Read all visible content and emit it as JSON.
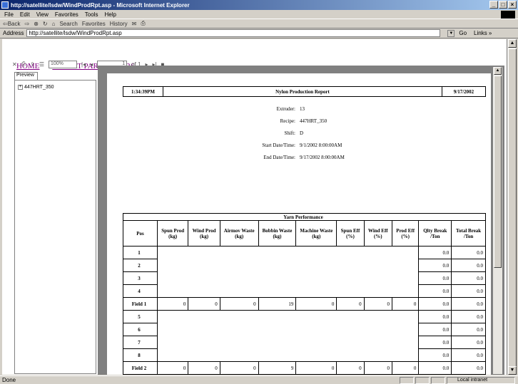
{
  "window": {
    "title": "http://satellite/lsdw/WindProdRpt.asp - Microsoft Internet Explorer"
  },
  "menu": {
    "items": [
      "File",
      "Edit",
      "View",
      "Favorites",
      "Tools",
      "Help"
    ]
  },
  "toolbar": {
    "back": "⇦Back",
    "search": "Search",
    "favorites": "Favorites",
    "history": "History"
  },
  "address": {
    "label": "Address",
    "url": "http://satellite/lsdw/WindProdRpt.asp",
    "go": "Go",
    "links": "Links »"
  },
  "nav": {
    "home": "HOME",
    "params": "REPORT PARAMETERS"
  },
  "viewer": {
    "zoom": "100%",
    "page": "1",
    "of": "of 1",
    "preview_tab": "Preview",
    "tree_node": "447HRT_350"
  },
  "report": {
    "time": "1:34:39PM",
    "title": "Nylon Production Report",
    "date": "9/17/2002",
    "info": [
      {
        "label": "Extruder:",
        "value": "13"
      },
      {
        "label": "Recipe:",
        "value": "447HRT_350"
      },
      {
        "label": "Shift:",
        "value": "D"
      },
      {
        "label": "Start Date/Time:",
        "value": "9/1/2002  8:00:00AM"
      },
      {
        "label": "End Date/Time:",
        "value": "9/17/2002  8:00:00AM"
      }
    ],
    "perf_title": "Yarn Performance",
    "columns": [
      "Pos",
      "Spun Prod (kg)",
      "Wind Prod (kg)",
      "Airmov Waste (kg)",
      "Bobbin Waste (kg)",
      "Machine Waste (kg)",
      "Spun Eff (%)",
      "Wind Eff (%)",
      "Prod Eff (%)",
      "Qlty Break /Ton",
      "Total Break /Ton"
    ],
    "pos_rows": [
      {
        "pos": "1",
        "qlty": "0.0",
        "total": "0.0"
      },
      {
        "pos": "2",
        "qlty": "0.0",
        "total": "0.0"
      },
      {
        "pos": "3",
        "qlty": "0.0",
        "total": "0.0"
      },
      {
        "pos": "4",
        "qlty": "0.0",
        "total": "0.0"
      },
      {
        "pos": "5",
        "qlty": "0.0",
        "total": "0.0"
      },
      {
        "pos": "6",
        "qlty": "0.0",
        "total": "0.0"
      },
      {
        "pos": "7",
        "qlty": "0.0",
        "total": "0.0"
      },
      {
        "pos": "8",
        "qlty": "0.0",
        "total": "0.0"
      }
    ],
    "field_rows": [
      {
        "pos": "Field 1",
        "values": [
          "0",
          "0",
          "0",
          "19",
          "0",
          "0",
          "0",
          "0",
          "0.0",
          "0.0"
        ]
      },
      {
        "pos": "Field 2",
        "values": [
          "0",
          "0",
          "0",
          "9",
          "0",
          "0",
          "0",
          "0",
          "0.0",
          "0.0"
        ]
      }
    ]
  },
  "status": {
    "text": "Done",
    "zone": "Local intranet"
  }
}
